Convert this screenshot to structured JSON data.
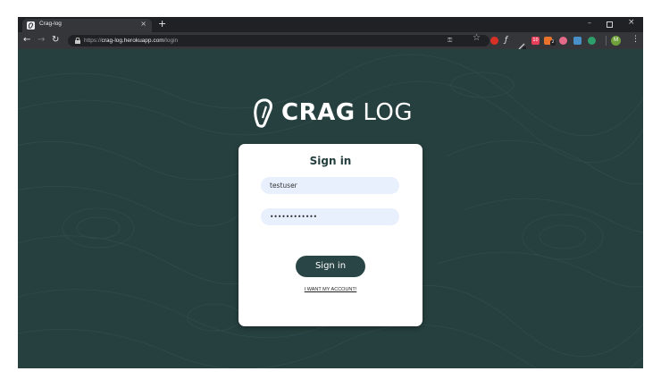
{
  "browser": {
    "tab_title": "Crag-log",
    "tab_close": "×",
    "new_tab": "+",
    "url_scheme": "https://",
    "url_host": "crag-log.herokuapp.com",
    "url_path": "/login",
    "window_controls": {
      "minimize": "–",
      "close": "×"
    },
    "profile_initial": "M",
    "extension_badges": [
      "10",
      "2"
    ]
  },
  "page": {
    "logo": {
      "bold": "CRAG",
      "light": "LOG"
    },
    "form": {
      "title": "Sign in",
      "username_value": "testuser",
      "password_value": "••••••••••••",
      "submit_label": "Sign in",
      "forgot_link": "I WANT MY ACCOUNT!"
    }
  },
  "colors": {
    "background": "#26403f",
    "button": "#2a4545",
    "field": "#e8f0fe"
  }
}
